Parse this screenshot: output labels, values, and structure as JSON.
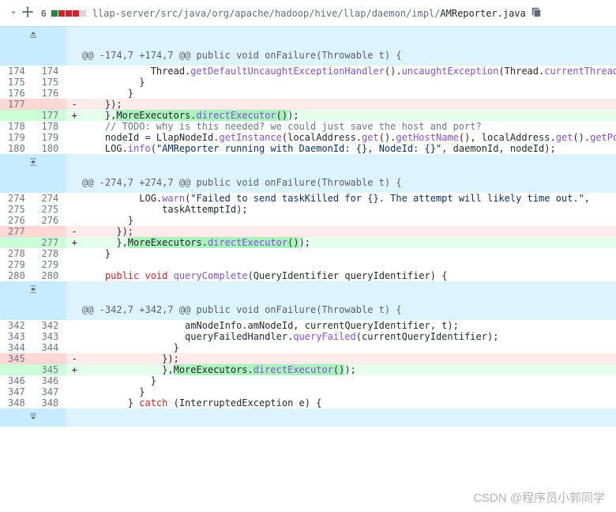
{
  "header": {
    "change_count": "6",
    "filepath_dir": "llap-server/src/java/org/apache/hadoop/hive/llap/daemon/impl/",
    "filepath_name": "AMReporter.java"
  },
  "hunks": {
    "h1": "@@ -174,7 +174,7 @@ public void onFailure(Throwable t) {",
    "h2": "@@ -274,7 +274,7 @@ public void onFailure(Throwable t) {",
    "h3": "@@ -342,7 +342,7 @@ public void onFailure(Throwable t) {"
  },
  "lines": {
    "l174o": "174",
    "l174n": "174",
    "c174": "            Thread.getDefaultUncaughtExceptionHandler().uncaughtException(Thread.currentThread(), t);",
    "l175o": "175",
    "l175n": "175",
    "c175": "          }",
    "l176o": "176",
    "l176n": "176",
    "c176": "        }",
    "l177o": "177",
    "c177d": "    });",
    "l177n": "177",
    "c177a": "    },MoreExecutors.directExecutor());",
    "l178o": "178",
    "l178n": "178",
    "c178": "    // TODO: why is this needed? we could just save the host and port?",
    "l179o": "179",
    "l179n": "179",
    "c179": "    nodeId = LlapNodeId.getInstance(localAddress.get().getHostName(), localAddress.get().getPort());",
    "l180o": "180",
    "l180n": "180",
    "c180": "    LOG.info(\"AMReporter running with DaemonId: {}, NodeId: {}\", daemonId, nodeId);",
    "l274o": "274",
    "l274n": "274",
    "c274": "          LOG.warn(\"Failed to send taskKilled for {}. The attempt will likely time out.\",",
    "l275o": "275",
    "l275n": "275",
    "c275": "              taskAttemptId);",
    "l276o": "276",
    "l276n": "276",
    "c276": "        }",
    "l277o": "277",
    "c277d": "      });",
    "l277n": "277",
    "c277a": "      },MoreExecutors.directExecutor());",
    "l278o": "278",
    "l278n": "278",
    "c278": "    }",
    "l279o": "279",
    "l279n": "279",
    "c279": "",
    "l280o": "280",
    "l280n": "280",
    "c280": "    public void queryComplete(QueryIdentifier queryIdentifier) {",
    "l342o": "342",
    "l342n": "342",
    "c342": "                  amNodeInfo.amNodeId, currentQueryIdentifier, t);",
    "l343o": "343",
    "l343n": "343",
    "c343": "                  queryFailedHandler.queryFailed(currentQueryIdentifier);",
    "l344o": "344",
    "l344n": "344",
    "c344": "                }",
    "l345o": "345",
    "c345d": "              });",
    "l345n": "345",
    "c345a": "              },MoreExecutors.directExecutor());",
    "l346o": "346",
    "l346n": "346",
    "c346": "            }",
    "l347o": "347",
    "l347n": "347",
    "c347": "          }",
    "l348o": "348",
    "l348n": "348",
    "c348": "        } catch (InterruptedException e) {"
  },
  "sign": {
    "minus": "-",
    "plus": "+",
    "blank": " "
  },
  "watermark": "CSDN @程序员小郭同学"
}
